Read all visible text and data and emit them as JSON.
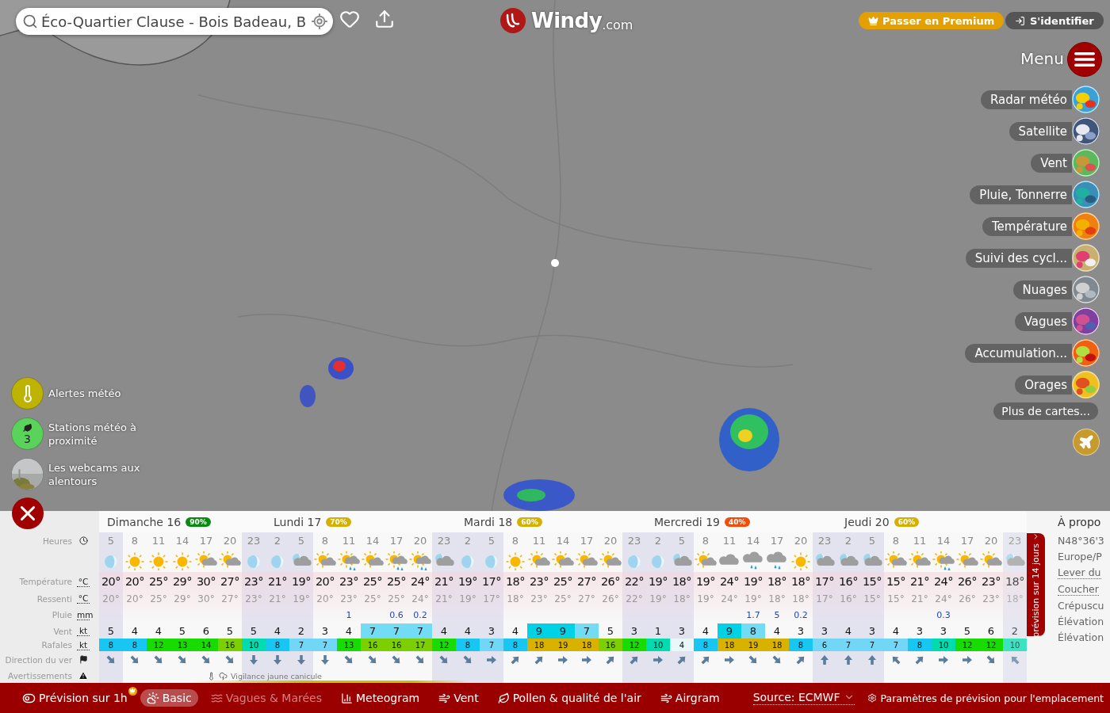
{
  "search": {
    "value": "Éco-Quartier Clause - Bois Badeau, B"
  },
  "logo": {
    "name": "Windy",
    "suffix": ".com"
  },
  "account": {
    "premium": "Passer en Premium",
    "login": "S'identifier"
  },
  "menu": {
    "label": "Menu"
  },
  "layers": [
    {
      "label": "Radar météo"
    },
    {
      "label": "Satellite"
    },
    {
      "label": "Vent"
    },
    {
      "label": "Pluie, Tonnerre"
    },
    {
      "label": "Température"
    },
    {
      "label": "Suivi des cycl..."
    },
    {
      "label": "Nuages"
    },
    {
      "label": "Vagues"
    },
    {
      "label": "Accumulation..."
    },
    {
      "label": "Orages"
    }
  ],
  "more_maps": "Plus de cartes...",
  "nearby": [
    {
      "kind": "alerts",
      "label": "Alertes météo"
    },
    {
      "kind": "stations",
      "label": "Stations météo à proximité",
      "count": "3"
    },
    {
      "kind": "webcams",
      "label": "Les webcams aux alentours"
    }
  ],
  "forecast": {
    "row_labels": [
      {
        "label": "Heures",
        "kind": "clock"
      },
      {
        "label": "Température",
        "unit": "°C"
      },
      {
        "label": "Ressenti",
        "unit": "°C"
      },
      {
        "label": "Pluie",
        "unit": "mm"
      },
      {
        "label": "Vent",
        "unit": "kt"
      },
      {
        "label": "Rafales",
        "unit": "kt"
      },
      {
        "label": "Direction du ver",
        "kind": "flag"
      },
      {
        "label": "Avertissements",
        "kind": "warning"
      }
    ],
    "days": [
      {
        "name": "Dimanche 16",
        "reliability": "90%",
        "color": "#0b8a12",
        "hours": [
          {
            "hour": "5",
            "night": true,
            "kind": "moon",
            "temp": "20°",
            "feels": "20°",
            "wind": "5",
            "gust": "8",
            "wind_direction": {
              "kind": "SE"
            }
          },
          {
            "hour": "8",
            "night": false,
            "kind": "sun",
            "temp": "20°",
            "feels": "20°",
            "wind": "4",
            "gust": "8",
            "wind_direction": {
              "kind": "SE"
            }
          },
          {
            "hour": "11",
            "night": false,
            "kind": "sun",
            "temp": "25°",
            "feels": "25°",
            "wind": "4",
            "gust": "12",
            "wind_direction": {
              "kind": "SE"
            }
          },
          {
            "hour": "14",
            "night": false,
            "kind": "sun",
            "temp": "29°",
            "feels": "29°",
            "wind": "5",
            "gust": "13",
            "wind_direction": {
              "kind": "SE"
            }
          },
          {
            "hour": "17",
            "night": false,
            "kind": "sun-cloud",
            "temp": "30°",
            "feels": "30°",
            "wind": "6",
            "gust": "14",
            "wind_direction": {
              "kind": "SE"
            }
          },
          {
            "hour": "20",
            "night": false,
            "kind": "sun-cloud",
            "temp": "27°",
            "feels": "27°",
            "wind": "5",
            "gust": "16",
            "wind_direction": {
              "kind": "SE"
            }
          },
          {
            "hour": "23",
            "night": true,
            "kind": "moon",
            "temp": "23°",
            "feels": "23°",
            "wind": "5",
            "gust": "10",
            "wind_direction": {
              "kind": "S"
            }
          }
        ]
      },
      {
        "name": "Lundi 17",
        "reliability": "70%",
        "color": "#d4b000",
        "hours": [
          {
            "hour": "2",
            "night": true,
            "kind": "moon",
            "temp": "21°",
            "feels": "21°",
            "wind": "4",
            "gust": "8",
            "wind_direction": {
              "kind": "S"
            }
          },
          {
            "hour": "5",
            "night": true,
            "kind": "moon-cloud",
            "temp": "19°",
            "feels": "19°",
            "wind": "2",
            "gust": "7",
            "wind_direction": {
              "kind": "S"
            }
          },
          {
            "hour": "8",
            "night": false,
            "kind": "sun-cloud",
            "temp": "20°",
            "feels": "20°",
            "wind": "3",
            "gust": "7",
            "wind_direction": {
              "kind": "S"
            }
          },
          {
            "hour": "11",
            "night": false,
            "kind": "sun-rain",
            "temp": "23°",
            "feels": "23°",
            "rain": "1",
            "wind": "4",
            "gust": "13",
            "wind_direction": {
              "kind": "SE"
            }
          },
          {
            "hour": "14",
            "night": false,
            "kind": "sun-cloud",
            "temp": "25°",
            "feels": "25°",
            "wind": "7",
            "gust": "16",
            "wind_direction": {
              "kind": "SE"
            }
          },
          {
            "hour": "17",
            "night": false,
            "kind": "sun-rain",
            "temp": "25°",
            "feels": "25°",
            "rain": "0.6",
            "wind": "7",
            "gust": "16",
            "wind_direction": {
              "kind": "SE"
            }
          },
          {
            "hour": "20",
            "night": false,
            "kind": "sun-rain",
            "temp": "24°",
            "feels": "24°",
            "rain": "0.2",
            "wind": "7",
            "gust": "17",
            "wind_direction": {
              "kind": "SE"
            }
          },
          {
            "hour": "23",
            "night": true,
            "kind": "moon-cloud",
            "temp": "21°",
            "feels": "21°",
            "wind": "4",
            "gust": "12",
            "wind_direction": {
              "kind": "SE"
            }
          }
        ]
      },
      {
        "name": "Mardi 18",
        "reliability": "60%",
        "color": "#d4b000",
        "hours": [
          {
            "hour": "2",
            "night": true,
            "kind": "moon",
            "temp": "19°",
            "feels": "19°",
            "wind": "4",
            "gust": "8",
            "wind_direction": {
              "kind": "SE"
            }
          },
          {
            "hour": "5",
            "night": true,
            "kind": "moon",
            "temp": "17°",
            "feels": "17°",
            "wind": "3",
            "gust": "7",
            "wind_direction": {
              "kind": "E"
            }
          },
          {
            "hour": "8",
            "night": false,
            "kind": "sun",
            "temp": "18°",
            "feels": "18°",
            "wind": "4",
            "gust": "8",
            "wind_direction": {
              "kind": "NE"
            }
          },
          {
            "hour": "11",
            "night": false,
            "kind": "sun-cloud",
            "temp": "23°",
            "feels": "23°",
            "wind": "9",
            "gust": "18",
            "wind_direction": {
              "kind": "NE"
            }
          },
          {
            "hour": "14",
            "night": false,
            "kind": "sun-cloud",
            "temp": "25°",
            "feels": "25°",
            "wind": "9",
            "gust": "19",
            "wind_direction": {
              "kind": "E"
            }
          },
          {
            "hour": "17",
            "night": false,
            "kind": "sun-cloud",
            "temp": "27°",
            "feels": "27°",
            "wind": "7",
            "gust": "18",
            "wind_direction": {
              "kind": "E"
            }
          },
          {
            "hour": "20",
            "night": false,
            "kind": "sun-cloud",
            "temp": "26°",
            "feels": "26°",
            "wind": "5",
            "gust": "16",
            "wind_direction": {
              "kind": "NE"
            }
          },
          {
            "hour": "23",
            "night": true,
            "kind": "moon",
            "temp": "22°",
            "feels": "22°",
            "wind": "3",
            "gust": "12",
            "wind_direction": {
              "kind": "NE"
            }
          }
        ]
      },
      {
        "name": "Mercredi 19",
        "reliability": "40%",
        "color": "#f04e0a",
        "hours": [
          {
            "hour": "2",
            "night": true,
            "kind": "moon",
            "temp": "19°",
            "feels": "19°",
            "wind": "1",
            "gust": "10",
            "wind_direction": {
              "kind": "E"
            }
          },
          {
            "hour": "5",
            "night": true,
            "kind": "moon-cloud",
            "temp": "18°",
            "feels": "18°",
            "wind": "3",
            "gust": "4",
            "wind_direction": {
              "kind": "NE"
            }
          },
          {
            "hour": "8",
            "night": false,
            "kind": "sun-cloud",
            "temp": "19°",
            "feels": "19°",
            "wind": "4",
            "gust": "8",
            "wind_direction": {
              "kind": "NE"
            }
          },
          {
            "hour": "11",
            "night": false,
            "kind": "cloud",
            "temp": "24°",
            "feels": "24°",
            "wind": "9",
            "gust": "18",
            "wind_direction": {
              "kind": "E"
            }
          },
          {
            "hour": "14",
            "night": false,
            "kind": "rain",
            "temp": "19°",
            "feels": "19°",
            "rain": "1.7",
            "wind": "8",
            "gust": "19",
            "wind_direction": {
              "kind": "SE"
            }
          },
          {
            "hour": "17",
            "night": false,
            "kind": "rain",
            "temp": "18°",
            "feels": "18°",
            "rain": "5",
            "wind": "4",
            "gust": "18",
            "wind_direction": {
              "kind": "SE"
            }
          },
          {
            "hour": "20",
            "night": false,
            "kind": "sun",
            "temp": "18°",
            "feels": "18°",
            "rain": "0.2",
            "wind": "3",
            "gust": "8",
            "wind_direction": {
              "kind": "NE"
            }
          },
          {
            "hour": "23",
            "night": true,
            "kind": "moon-cloud",
            "temp": "17°",
            "feels": "17°",
            "wind": "3",
            "gust": "6",
            "wind_direction": {
              "kind": "N"
            }
          }
        ]
      },
      {
        "name": "Jeudi 20",
        "reliability": "60%",
        "color": "#d4b000",
        "hours": [
          {
            "hour": "2",
            "night": true,
            "kind": "moon-cloud",
            "temp": "16°",
            "feels": "16°",
            "wind": "4",
            "gust": "7",
            "wind_direction": {
              "kind": "N"
            }
          },
          {
            "hour": "5",
            "night": true,
            "kind": "moon-cloud",
            "temp": "15°",
            "feels": "15°",
            "wind": "3",
            "gust": "7",
            "wind_direction": {
              "kind": "N"
            }
          },
          {
            "hour": "8",
            "night": false,
            "kind": "sun-cloud",
            "temp": "15°",
            "feels": "15°",
            "wind": "4",
            "gust": "7",
            "wind_direction": {
              "kind": "NW"
            }
          },
          {
            "hour": "11",
            "night": false,
            "kind": "sun-cloud",
            "temp": "21°",
            "feels": "21°",
            "wind": "3",
            "gust": "8",
            "wind_direction": {
              "kind": "NE"
            }
          },
          {
            "hour": "14",
            "night": false,
            "kind": "sun-rain",
            "temp": "24°",
            "feels": "24°",
            "rain": "0.3",
            "wind": "3",
            "gust": "10",
            "wind_direction": {
              "kind": "E"
            }
          },
          {
            "hour": "17",
            "night": false,
            "kind": "sun-cloud",
            "temp": "26°",
            "feels": "26°",
            "wind": "5",
            "gust": "12",
            "wind_direction": {
              "kind": "E"
            }
          },
          {
            "hour": "20",
            "night": false,
            "kind": "sun-cloud",
            "temp": "23°",
            "feels": "23°",
            "wind": "6",
            "gust": "12",
            "wind_direction": {
              "kind": "SE"
            }
          },
          {
            "hour": "23",
            "night": true,
            "kind": "moon-cloud",
            "temp": "18°",
            "feels": "18°",
            "wind": "2",
            "gust": "10",
            "wind_direction": {
              "kind": "NW"
            }
          }
        ]
      }
    ],
    "warning": "Vigilance jaune canicule",
    "long_range_tab": "prévision sur 14 jours"
  },
  "about": {
    "title": "À propo",
    "lines": [
      {
        "text": "N48°36'3",
        "underlined": false
      },
      {
        "text": "Europe/P",
        "underlined": false
      },
      {
        "text": "Lever du",
        "underlined": true
      },
      {
        "text": "Coucher",
        "underlined": true
      },
      {
        "text": "Crépuscu",
        "underlined": false
      },
      {
        "text": "Élévation",
        "underlined": false
      },
      {
        "text": "Élévation",
        "underlined": false
      }
    ]
  },
  "bottom_bar": {
    "tabs": [
      {
        "kind": "toggle",
        "label": "Prévision sur 1h",
        "selected": false,
        "disabled": false,
        "premium": true
      },
      {
        "kind": "basic",
        "label": "Basic",
        "selected": true,
        "disabled": false,
        "premium": false
      },
      {
        "kind": "waves",
        "label": "Vagues & Marées",
        "selected": false,
        "disabled": true,
        "premium": false
      },
      {
        "kind": "meteogram",
        "label": "Meteogram",
        "selected": false,
        "disabled": false,
        "premium": false
      },
      {
        "kind": "wind",
        "label": "Vent",
        "selected": false,
        "disabled": false,
        "premium": false
      },
      {
        "kind": "pollen",
        "label": "Pollen & qualité de l'air",
        "selected": false,
        "disabled": false,
        "premium": false
      },
      {
        "kind": "airgram",
        "label": "Airgram",
        "selected": false,
        "disabled": false,
        "premium": false
      }
    ],
    "source": "Source: ECMWF",
    "settings": "Paramètres de prévision pour l'emplacement"
  }
}
